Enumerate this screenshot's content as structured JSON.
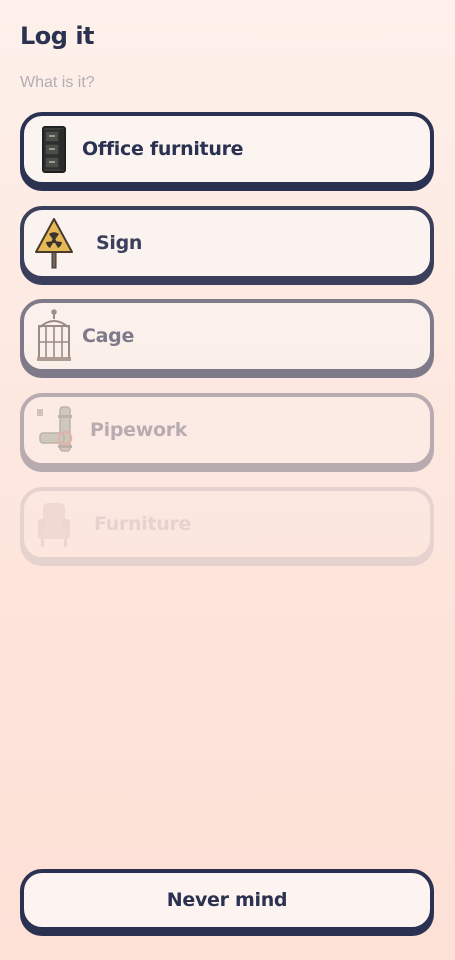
{
  "header": {
    "title": "Log it",
    "prompt": "What is it?"
  },
  "options": [
    {
      "label": "Office furniture",
      "icon": "filing-cabinet-icon"
    },
    {
      "label": "Sign",
      "icon": "radiation-sign-icon"
    },
    {
      "label": "Cage",
      "icon": "cage-icon"
    },
    {
      "label": "Pipework",
      "icon": "pipework-icon"
    },
    {
      "label": "Furniture",
      "icon": "armchair-icon"
    }
  ],
  "footer": {
    "cancel_label": "Never mind"
  },
  "colors": {
    "ink": "#2b3150",
    "card": "#fbf4f1",
    "background_top": "#fdf0ea",
    "background_bottom": "#fde0d6",
    "muted_text": "#b3aeb4"
  }
}
